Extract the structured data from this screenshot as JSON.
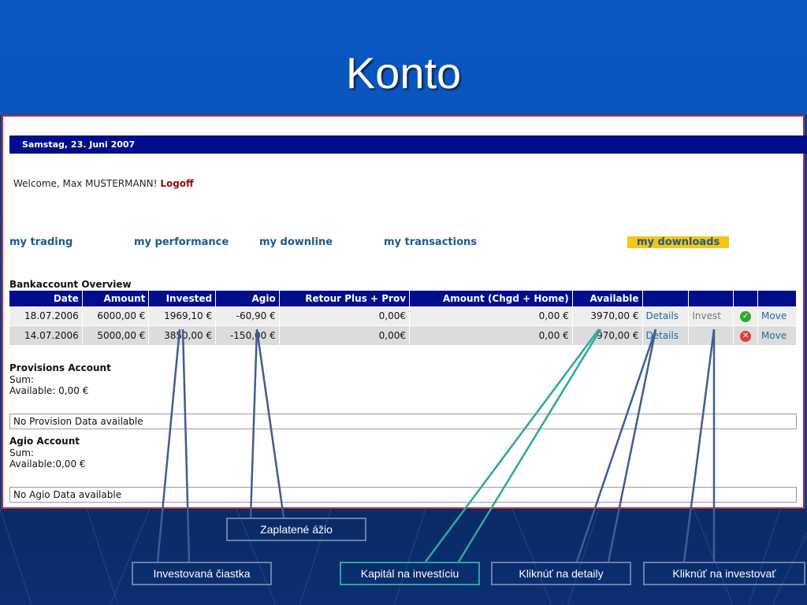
{
  "slide": {
    "title": "Konto"
  },
  "app": {
    "date": "Samstag, 23. Juni 2007",
    "welcome_prefix": "Welcome, Max MUSTERMANN!",
    "logoff": "Logoff",
    "nav": [
      {
        "label": "my trading"
      },
      {
        "label": "my performance"
      },
      {
        "label": "my downline"
      },
      {
        "label": "my transactions"
      },
      {
        "label": "my downloads",
        "active": true
      }
    ]
  },
  "bank": {
    "title": "Bankaccount Overview",
    "columns": [
      "Date",
      "Amount",
      "Invested",
      "Agio",
      "Retour Plus + Prov",
      "Amount (Chgd + Home)",
      "Available"
    ],
    "rows": [
      {
        "date": "18.07.2006",
        "amount": "6000,00 €",
        "invested": "1969,10 €",
        "agio": "-60,90 €",
        "retour": "0,00€",
        "amount_chgd": "0,00 €",
        "available": "3970,00 €",
        "details": "Details",
        "invest": "Invest",
        "status_icon": "check-icon",
        "move": "Move"
      },
      {
        "date": "14.07.2006",
        "amount": "5000,00 €",
        "invested": "3850,00 €",
        "agio": "-150,00 €",
        "retour": "0,00€",
        "amount_chgd": "0,00 €",
        "available": "970,00 €",
        "details": "Details",
        "invest": "",
        "status_icon": "x-icon",
        "move": "Move"
      }
    ]
  },
  "provisions": {
    "title": "Provisions Account",
    "sum": "Sum:",
    "available": "Available: 0,00 €",
    "nodata": "No Provision Data available"
  },
  "agio": {
    "title": "Agio Account",
    "sum": "Sum:",
    "available": "Available:0,00 €",
    "nodata": "No Agio Data available"
  },
  "callouts": {
    "agio_paid": "Zaplatené ážio",
    "invested": "Investovaná čiastka",
    "capital": "Kapitál na investíciu",
    "details": "Kliknúť na detaily",
    "invest": "Kliknúť na investovať"
  },
  "colors": {
    "slide_bg": "#0b58c4",
    "header_bar": "#000d8c",
    "link": "#1b5a8c",
    "active_nav": "#f5c518",
    "panel_border": "#c8262a",
    "callout_border": "#6b7fa8",
    "callout_teal": "#2aa89c"
  }
}
